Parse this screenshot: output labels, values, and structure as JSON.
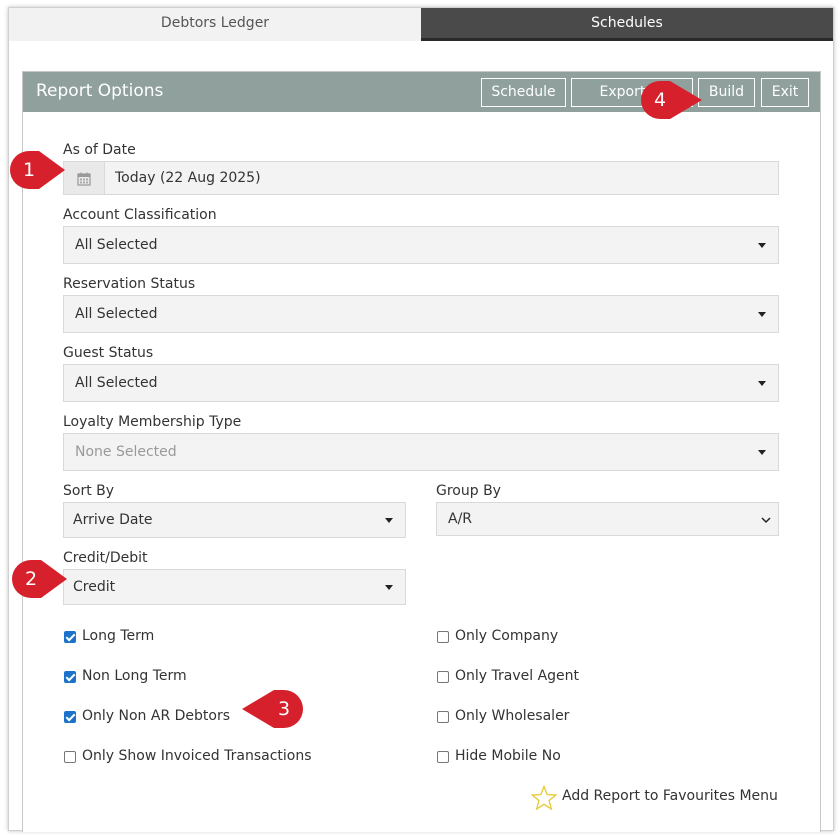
{
  "tabs": [
    {
      "label": "Debtors Ledger",
      "active": true
    },
    {
      "label": "Schedules",
      "active": false
    }
  ],
  "panel": {
    "title": "Report Options",
    "buttons": {
      "schedule": "Schedule",
      "export": "Export To",
      "build": "Build",
      "exit": "Exit"
    }
  },
  "form": {
    "as_of_date": {
      "label": "As of Date",
      "value": "Today (22 Aug 2025)",
      "icon": "calendar-icon"
    },
    "account_classification": {
      "label": "Account Classification",
      "value": "All Selected"
    },
    "reservation_status": {
      "label": "Reservation Status",
      "value": "All Selected"
    },
    "guest_status": {
      "label": "Guest Status",
      "value": "All Selected"
    },
    "loyalty_membership_type": {
      "label": "Loyalty Membership Type",
      "placeholder": "None Selected"
    },
    "sort_by": {
      "label": "Sort By",
      "value": "Arrive Date"
    },
    "group_by": {
      "label": "Group By",
      "value": "A/R"
    },
    "credit_debit": {
      "label": "Credit/Debit",
      "value": "Credit"
    }
  },
  "checkboxes": {
    "long_term": {
      "label": "Long Term",
      "checked": true
    },
    "non_long_term": {
      "label": "Non Long Term",
      "checked": true
    },
    "only_non_ar_debtors": {
      "label": "Only Non AR Debtors",
      "checked": true
    },
    "only_show_invoiced": {
      "label": "Only Show Invoiced Transactions",
      "checked": false
    },
    "only_company": {
      "label": "Only Company",
      "checked": false
    },
    "only_travel_agent": {
      "label": "Only Travel Agent",
      "checked": false
    },
    "only_wholesaler": {
      "label": "Only Wholesaler",
      "checked": false
    },
    "hide_mobile_no": {
      "label": "Hide Mobile No",
      "checked": false
    }
  },
  "favourites": {
    "label": "Add Report to Favourites Menu",
    "icon": "star-outline-icon"
  },
  "callouts": [
    "1",
    "2",
    "3",
    "4"
  ],
  "colors": {
    "header": "#8fa09d",
    "checkbox": "#1a73c9",
    "callout": "#d6202c"
  }
}
